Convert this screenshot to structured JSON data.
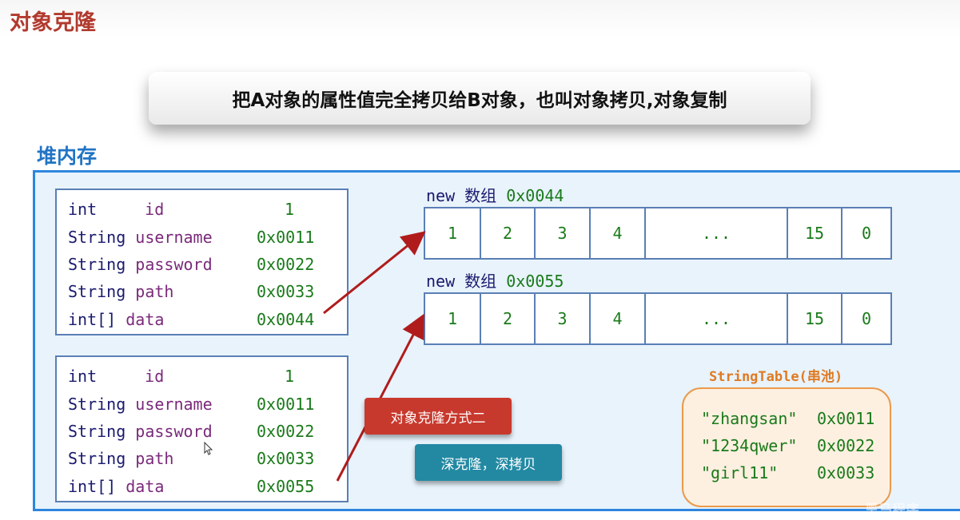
{
  "title": "对象克隆",
  "banner": "把A对象的属性值完全拷贝给B对象，也叫对象拷贝,对象复制",
  "heap_label": "堆内存",
  "objects": [
    {
      "rows": [
        {
          "type": "int",
          "name": "id",
          "value": "1"
        },
        {
          "type": "String",
          "name": "username",
          "value": "0x0011"
        },
        {
          "type": "String",
          "name": "password",
          "value": "0x0022"
        },
        {
          "type": "String",
          "name": "path",
          "value": "0x0033"
        },
        {
          "type": "int[]",
          "name": "data",
          "value": "0x0044"
        }
      ]
    },
    {
      "rows": [
        {
          "type": "int",
          "name": "id",
          "value": "1"
        },
        {
          "type": "String",
          "name": "username",
          "value": "0x0011"
        },
        {
          "type": "String",
          "name": "password",
          "value": "0x0022"
        },
        {
          "type": "String",
          "name": "path",
          "value": "0x0033"
        },
        {
          "type": "int[]",
          "name": "data",
          "value": "0x0055"
        }
      ]
    }
  ],
  "arrays": [
    {
      "keyword": "new",
      "label": "数组",
      "address": "0x0044",
      "cells": [
        "1",
        "2",
        "3",
        "4",
        "...",
        "15",
        "0"
      ]
    },
    {
      "keyword": "new",
      "label": "数组",
      "address": "0x0055",
      "cells": [
        "1",
        "2",
        "3",
        "4",
        "...",
        "15",
        "0"
      ]
    }
  ],
  "buttons": {
    "clone_method_two": "对象克隆方式二",
    "deep_clone": "深克隆，深拷贝"
  },
  "string_pool": {
    "title": "StringTable(串池)",
    "entries": [
      {
        "value": "\"zhangsan\"",
        "address": "0x0011"
      },
      {
        "value": "\"1234qwer\"",
        "address": "0x0022"
      },
      {
        "value": "\"girl11\"",
        "address": "0x0033"
      }
    ]
  },
  "watermark": "黑马程序",
  "colors": {
    "title": "#b23a2e",
    "heap": "#2e86de",
    "arrow": "#b01c1c",
    "button_red": "#c8392d",
    "button_teal": "#2389a3",
    "pool_border": "#eb9a4c",
    "address_green": "#1a7a1a"
  },
  "icons": {
    "arrow_style": "arrow-right-icon",
    "cursor": "mouse-pointer-icon"
  }
}
